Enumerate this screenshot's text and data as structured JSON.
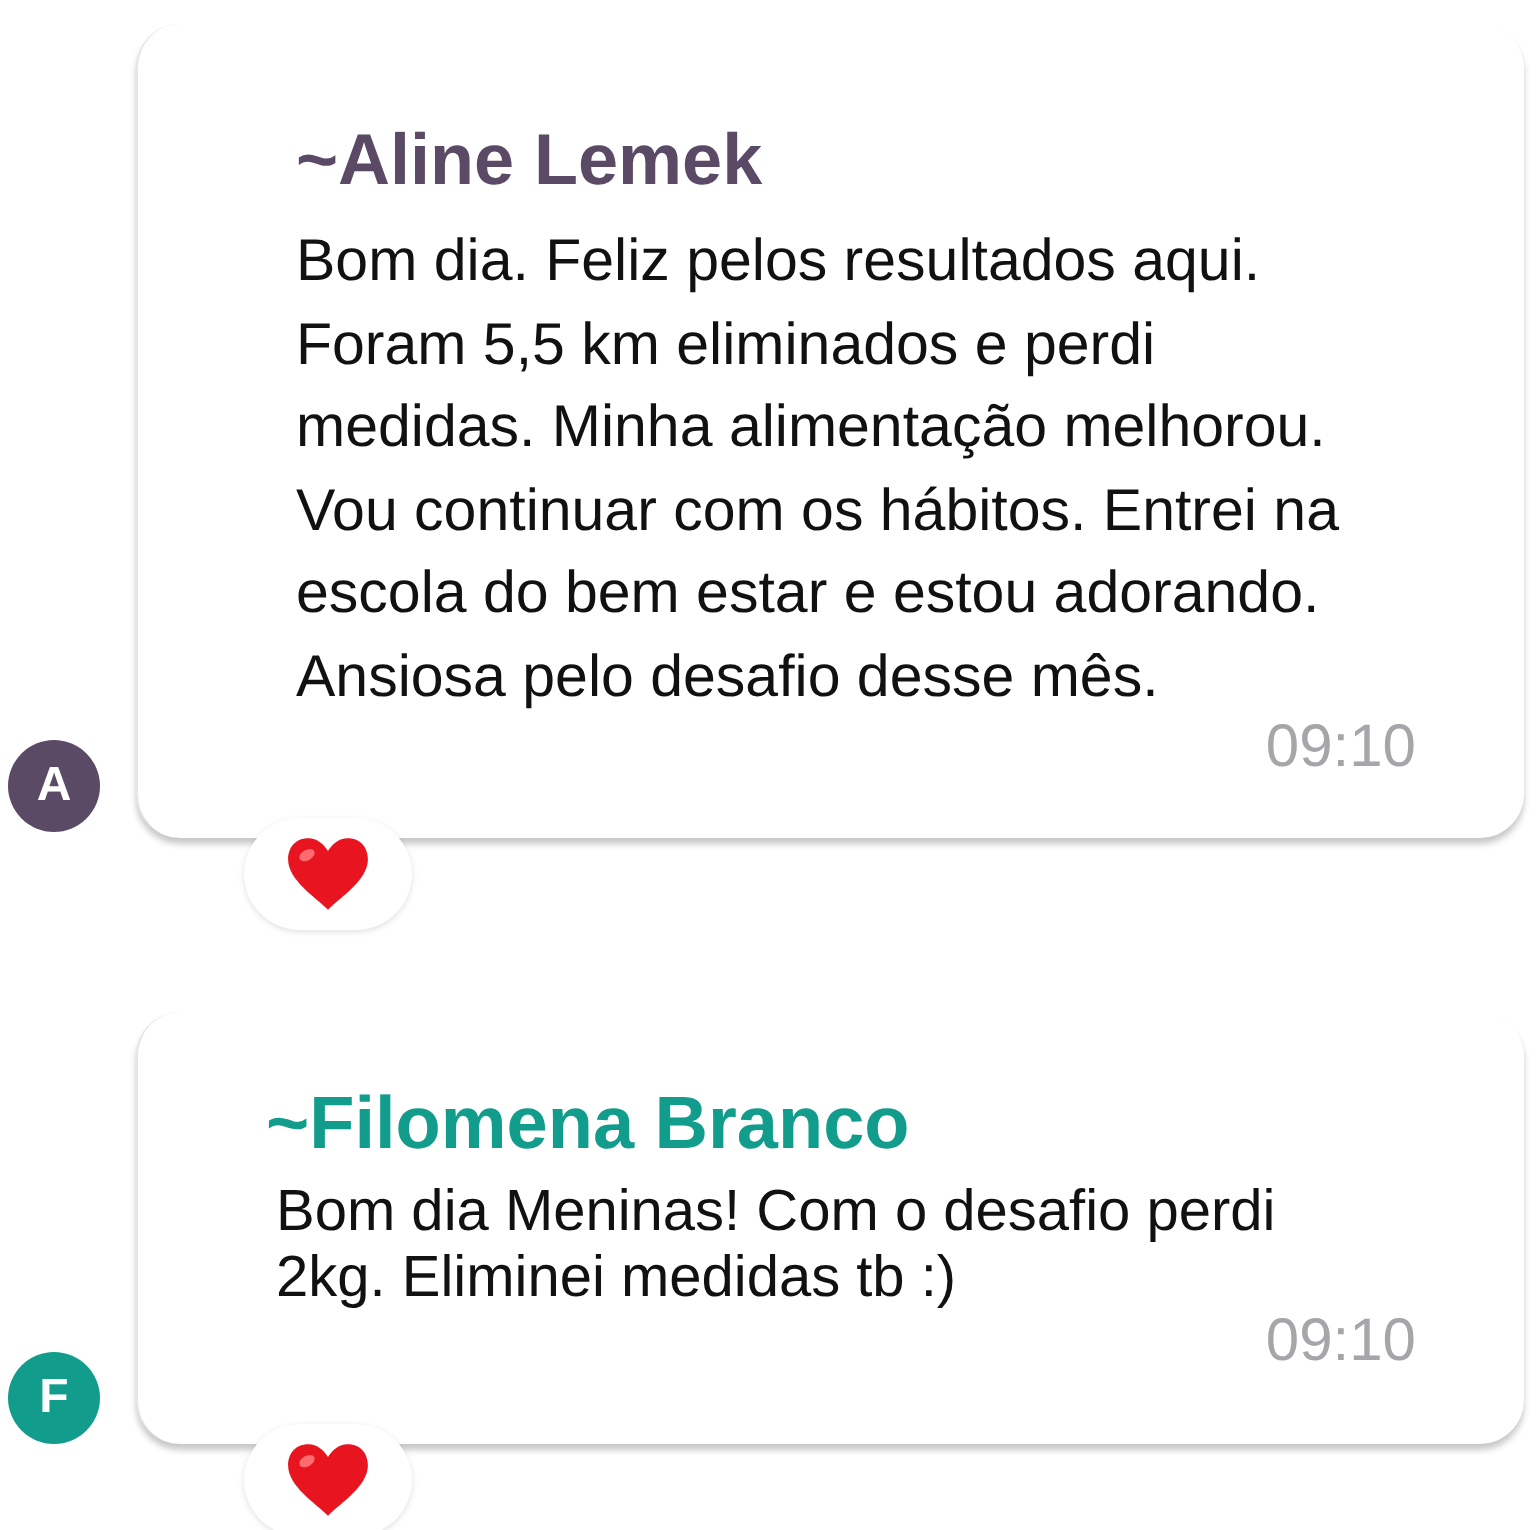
{
  "messages": [
    {
      "sender": "~Aline Lemek",
      "color": "#5b4a66",
      "avatar": "A",
      "text": "Bom dia. Feliz pelos resultados aqui.\nForam 5,5 km eliminados e perdi\nmedidas. Minha alimentação melhorou.\nVou continuar com os hábitos. Entrei na\nescola do bem estar e estou adorando.\nAnsiosa pelo desafio desse mês.",
      "time": "09:10",
      "reaction": {
        "kind": "heart"
      }
    },
    {
      "sender": "~Filomena Branco",
      "color": "#119c8c",
      "avatar": "F",
      "text": "Bom dia Meninas! Com o desafio perdi\n2kg. Eliminei medidas tb :)",
      "time": "09:10",
      "reaction": {
        "kind": "heart"
      }
    }
  ]
}
